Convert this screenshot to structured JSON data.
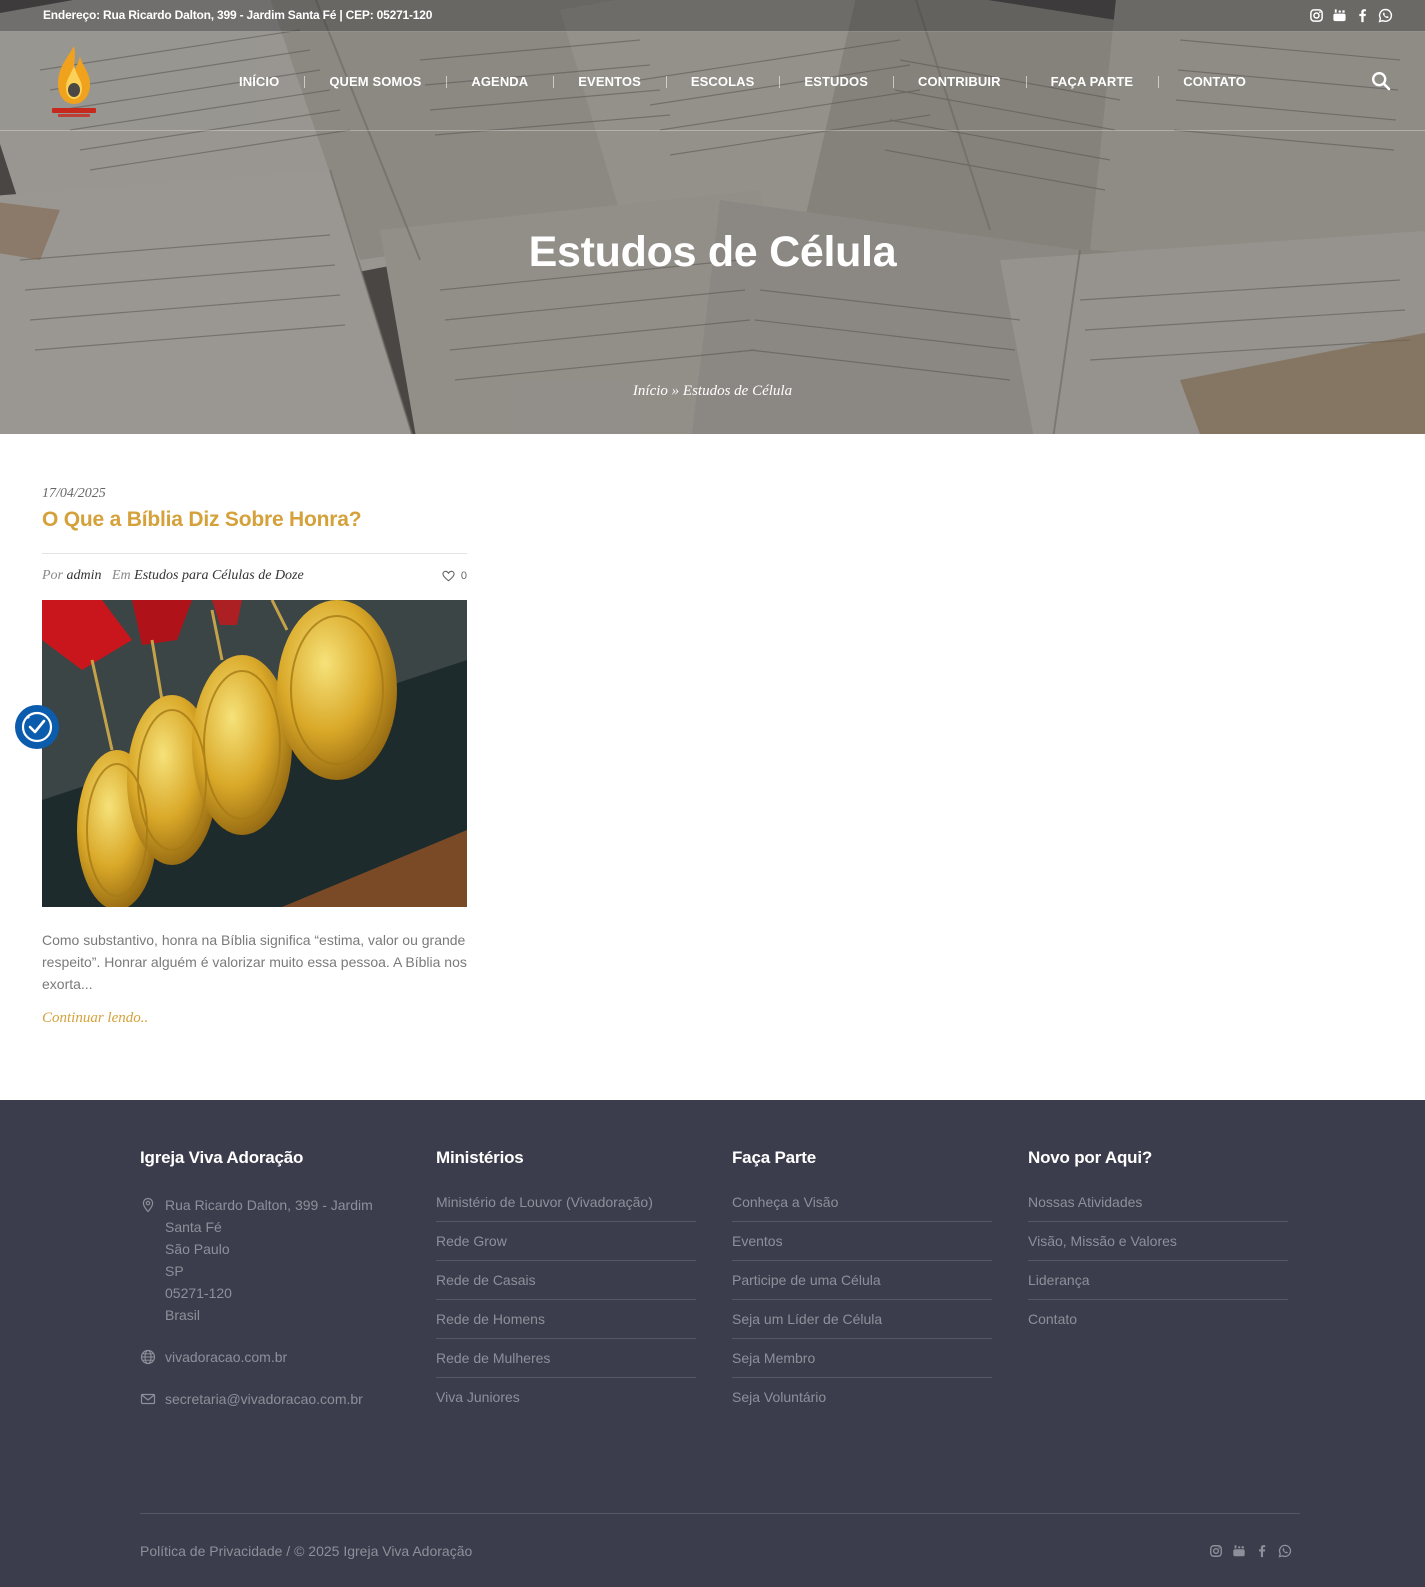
{
  "topbar": {
    "address": "Endereço: Rua Ricardo Dalton, 399 - Jardim Santa Fé | CEP: 05271-120",
    "social": [
      "instagram-icon",
      "youtube-icon",
      "facebook-icon",
      "whatsapp-icon"
    ]
  },
  "nav": {
    "items": [
      "INÍCIO",
      "QUEM SOMOS",
      "AGENDA",
      "EVENTOS",
      "ESCOLAS",
      "ESTUDOS",
      "CONTRIBUIR",
      "FAÇA PARTE",
      "CONTATO"
    ],
    "search_icon": "search-icon"
  },
  "hero": {
    "title": "Estudos de Célula",
    "breadcrumb": {
      "home": "Início",
      "separator": "»",
      "current": "Estudos de Célula"
    }
  },
  "post": {
    "date": "17/04/2025",
    "title": "O Que a Bíblia Diz Sobre Honra?",
    "by_label": "Por",
    "author": "admin",
    "in_label": "Em",
    "category": "Estudos para Células de Doze",
    "likes": "0",
    "excerpt": "Como substantivo, honra na Bíblia significa “estima, valor ou grande respeito”. Honrar alguém é valorizar muito essa pessoa. A Bíblia nos exorta...",
    "read_more": "Continuar lendo.."
  },
  "footer": {
    "col1": {
      "title": "Igreja Viva Adoração",
      "address_lines": [
        "Rua Ricardo Dalton, 399 - Jardim",
        "Santa Fé",
        "São Paulo",
        "SP",
        "05271-120",
        "Brasil"
      ],
      "website": "vivadoracao.com.br",
      "email": "secretaria@vivadoracao.com.br"
    },
    "col2": {
      "title": "Ministérios",
      "items": [
        "Ministério de Louvor (Vivadoração)",
        "Rede Grow",
        "Rede de Casais",
        "Rede de Homens",
        "Rede de Mulheres",
        "Viva Juniores"
      ]
    },
    "col3": {
      "title": "Faça Parte",
      "items": [
        "Conheça a Visão",
        "Eventos",
        "Participe de uma Célula",
        "Seja um Líder de Célula",
        "Seja Membro",
        "Seja Voluntário"
      ]
    },
    "col4": {
      "title": "Novo por Aqui?",
      "items": [
        "Nossas Atividades",
        "Visão, Missão e Valores",
        "Liderança",
        "Contato"
      ]
    },
    "privacy": "Política de Privacidade",
    "copyright": " / © 2025 Igreja Viva Adoração"
  },
  "colors": {
    "accent": "#d4a13a",
    "footer_bg": "#3c3d4c",
    "footer_text": "#8e8f9a",
    "a11y_blue": "#0b5cad"
  }
}
